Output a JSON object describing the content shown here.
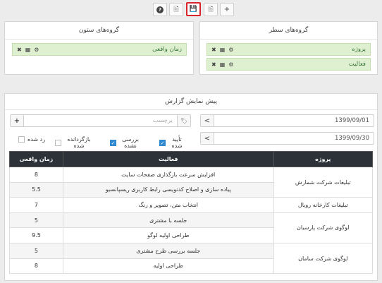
{
  "toolbar": {
    "add": "+",
    "doc": "🗎",
    "save": "💾",
    "export": "🖹",
    "help": "?"
  },
  "row_groups": {
    "title": "گروه‌های سطر",
    "items": [
      {
        "label": "پروژه"
      },
      {
        "label": "فعالیت"
      }
    ]
  },
  "col_groups": {
    "title": "گروه‌های ستون",
    "items": [
      {
        "label": "زمان واقعی"
      }
    ]
  },
  "preview": {
    "title": "پیش نمایش گزارش",
    "date_from": "1399/09/01",
    "date_to": "1399/09/30",
    "tag_placeholder": "برچسب",
    "tag_add": "+",
    "prev": "<",
    "tag_icon": "🏷",
    "checks": [
      {
        "label": "تأیید شده",
        "checked": true
      },
      {
        "label": "بررسی نشده",
        "checked": true
      },
      {
        "label": "بازگردانده شده",
        "checked": false
      },
      {
        "label": "رد شده",
        "checked": false
      }
    ]
  },
  "table": {
    "headers": {
      "project": "پروژه",
      "activity": "فعالیت",
      "time": "زمان واقعی"
    },
    "rows": [
      {
        "project": "تبلیغات شرکت شمارش",
        "activity": "افزایش سرعت بارگذاری صفحات سایت",
        "time": "8"
      },
      {
        "project": "",
        "activity": "پیاده سازی و اصلاح کدنویسی رابط کاربری ریسپانسیو",
        "time": "5.5"
      },
      {
        "project": "تبلیغات کارخانه رویال",
        "activity": "انتخاب متن، تصویر و رنگ",
        "time": "7"
      },
      {
        "project": "لوگوی شرکت پارسیان",
        "activity": "جلسه با مشتری",
        "time": "5"
      },
      {
        "project": "",
        "activity": "طراحی اولیه لوگو",
        "time": "9.5"
      },
      {
        "project": "لوگوی شرکت سامان",
        "activity": "جلسه بررسی طرح مشتری",
        "time": "5"
      },
      {
        "project": "",
        "activity": "طراحی اولیه",
        "time": "8"
      }
    ]
  }
}
